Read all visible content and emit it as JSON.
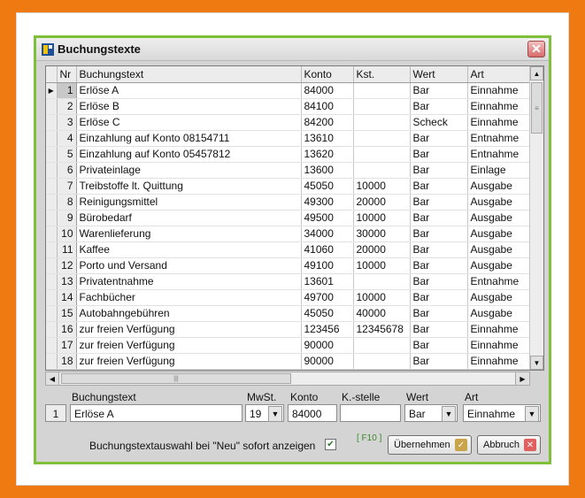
{
  "window": {
    "title": "Buchungstexte",
    "icon": "app-icon",
    "close_icon": "close-icon"
  },
  "grid": {
    "columns": [
      "Nr",
      "Buchungstext",
      "Konto",
      "Kst.",
      "Wert",
      "Art"
    ],
    "rows": [
      {
        "nr": "1",
        "text": "Erlöse A",
        "konto": "84000",
        "kst": "",
        "wert": "Bar",
        "art": "Einnahme"
      },
      {
        "nr": "2",
        "text": "Erlöse B",
        "konto": "84100",
        "kst": "",
        "wert": "Bar",
        "art": "Einnahme"
      },
      {
        "nr": "3",
        "text": "Erlöse C",
        "konto": "84200",
        "kst": "",
        "wert": "Scheck",
        "art": "Einnahme"
      },
      {
        "nr": "4",
        "text": "Einzahlung auf Konto 08154711",
        "konto": "13610",
        "kst": "",
        "wert": "Bar",
        "art": "Entnahme"
      },
      {
        "nr": "5",
        "text": "Einzahlung auf Konto 05457812",
        "konto": "13620",
        "kst": "",
        "wert": "Bar",
        "art": "Entnahme"
      },
      {
        "nr": "6",
        "text": "Privateinlage",
        "konto": "13600",
        "kst": "",
        "wert": "Bar",
        "art": "Einlage"
      },
      {
        "nr": "7",
        "text": "Treibstoffe lt. Quittung",
        "konto": "45050",
        "kst": "10000",
        "wert": "Bar",
        "art": "Ausgabe"
      },
      {
        "nr": "8",
        "text": "Reinigungsmittel",
        "konto": "49300",
        "kst": "20000",
        "wert": "Bar",
        "art": "Ausgabe"
      },
      {
        "nr": "9",
        "text": "Bürobedarf",
        "konto": "49500",
        "kst": "10000",
        "wert": "Bar",
        "art": "Ausgabe"
      },
      {
        "nr": "10",
        "text": "Warenlieferung",
        "konto": "34000",
        "kst": "30000",
        "wert": "Bar",
        "art": "Ausgabe"
      },
      {
        "nr": "11",
        "text": "Kaffee",
        "konto": "41060",
        "kst": "20000",
        "wert": "Bar",
        "art": "Ausgabe"
      },
      {
        "nr": "12",
        "text": "Porto und Versand",
        "konto": "49100",
        "kst": "10000",
        "wert": "Bar",
        "art": "Ausgabe"
      },
      {
        "nr": "13",
        "text": "Privatentnahme",
        "konto": "13601",
        "kst": "",
        "wert": "Bar",
        "art": "Entnahme"
      },
      {
        "nr": "14",
        "text": "Fachbücher",
        "konto": "49700",
        "kst": "10000",
        "wert": "Bar",
        "art": "Ausgabe"
      },
      {
        "nr": "15",
        "text": "Autobahngebühren",
        "konto": "45050",
        "kst": "40000",
        "wert": "Bar",
        "art": "Ausgabe"
      },
      {
        "nr": "16",
        "text": "zur freien Verfügung",
        "konto": "123456",
        "kst": "12345678",
        "wert": "Bar",
        "art": "Einnahme"
      },
      {
        "nr": "17",
        "text": "zur freien Verfügung",
        "konto": "90000",
        "kst": "",
        "wert": "Bar",
        "art": "Einnahme"
      },
      {
        "nr": "18",
        "text": "zur freien Verfügung",
        "konto": "90000",
        "kst": "",
        "wert": "Bar",
        "art": "Einnahme"
      }
    ],
    "selected_row": 0
  },
  "edit": {
    "labels": {
      "text": "Buchungstext",
      "mwst": "MwSt.",
      "konto": "Konto",
      "kstelle": "K.-stelle",
      "wert": "Wert",
      "art": "Art"
    },
    "values": {
      "nr": "1",
      "text": "Erlöse A",
      "mwst": "19",
      "konto": "84000",
      "kstelle": "",
      "wert": "Bar",
      "art": "Einnahme"
    }
  },
  "footer": {
    "checkbox_label": "Buchungstextauswahl bei \"Neu\" sofort anzeigen",
    "checkbox_checked": true,
    "hotkey": "[ F10 ]",
    "ok_label": "Übernehmen",
    "cancel_label": "Abbruch"
  },
  "colors": {
    "background": "#f07a12",
    "window_border": "#7fbf3a"
  }
}
